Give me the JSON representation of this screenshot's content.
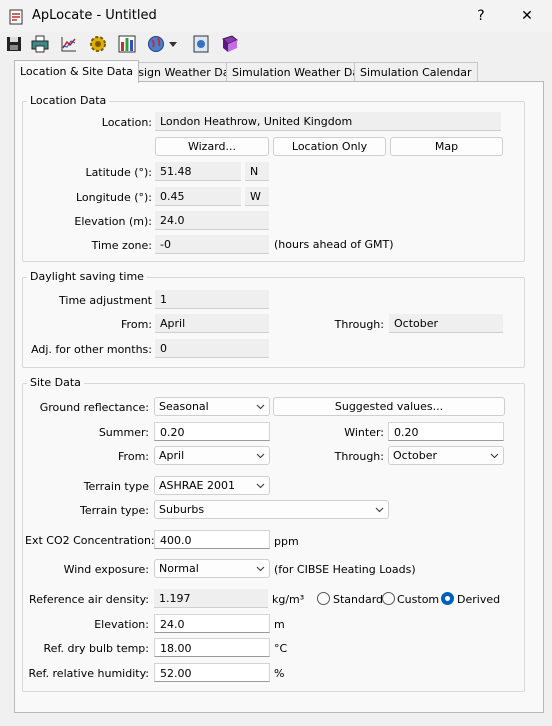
{
  "window": {
    "title": "ApLocate - Untitled",
    "help_glyph": "?",
    "close_glyph": "✕"
  },
  "toolbar": {
    "icons": [
      "save-icon",
      "print-icon",
      "chart-icon",
      "settings-gear-icon",
      "bar-chart-icon",
      "globe-icon",
      "dropdown-arrow-icon",
      "map-icon",
      "help-book-icon"
    ]
  },
  "tabs": [
    {
      "label": "Location & Site Data",
      "active": true
    },
    {
      "label": "Design Weather Data",
      "active": false
    },
    {
      "label": "Simulation Weather Data",
      "active": false
    },
    {
      "label": "Simulation Calendar",
      "active": false
    }
  ],
  "location": {
    "group_title": "Location Data",
    "location_label": "Location:",
    "location_value": "London Heathrow, United Kingdom",
    "wizard_button": "Wizard...",
    "location_only_button": "Location Only",
    "map_button": "Map",
    "latitude_label": "Latitude (°):",
    "latitude_value": "51.48",
    "latitude_dir": "N",
    "longitude_label": "Longitude (°):",
    "longitude_value": "0.45",
    "longitude_dir": "W",
    "elevation_label": "Elevation (m):",
    "elevation_value": "24.0",
    "timezone_label": "Time zone:",
    "timezone_value": "-0",
    "timezone_note": "(hours ahead of GMT)"
  },
  "dst": {
    "group_title": "Daylight saving time",
    "adjustment_label": "Time adjustment",
    "adjustment_value": "1",
    "from_label": "From:",
    "from_value": "April",
    "through_label": "Through:",
    "through_value": "October",
    "other_label": "Adj. for other months:",
    "other_value": "0"
  },
  "site": {
    "group_title": "Site Data",
    "ground_label": "Ground reflectance:",
    "ground_value": "Seasonal",
    "suggested_button": "Suggested values...",
    "summer_label": "Summer:",
    "summer_value": "0.20",
    "winter_label": "Winter:",
    "winter_value": "0.20",
    "from_label": "From:",
    "from_value": "April",
    "through_label": "Through:",
    "through_value": "October",
    "terrain_type_label": "Terrain type",
    "terrain_type_value": "ASHRAE 2001",
    "terrain_type2_label": "Terrain type:",
    "terrain_type2_value": "Suburbs",
    "co2_label": "Ext CO2 Concentration:",
    "co2_value": "400.0",
    "co2_unit": "ppm",
    "wind_label": "Wind exposure:",
    "wind_value": "Normal",
    "wind_note": "(for CIBSE Heating Loads)",
    "air_density_label": "Reference air density:",
    "air_density_value": "1.197",
    "air_density_unit": "kg/m³",
    "radio_standard": "Standard",
    "radio_custom": "Custom",
    "radio_derived": "Derived",
    "radio_selected": "Derived",
    "elevation_label": "Elevation:",
    "elevation_value": "24.0",
    "elevation_unit": "m",
    "dry_bulb_label": "Ref. dry bulb temp:",
    "dry_bulb_value": "18.00",
    "dry_bulb_unit": "°C",
    "humidity_label": "Ref. relative humidity:",
    "humidity_value": "52.00",
    "humidity_unit": "%"
  }
}
